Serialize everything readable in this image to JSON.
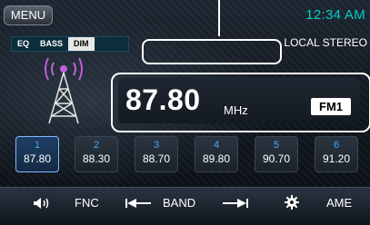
{
  "header": {
    "menu_label": "MENU",
    "clock": "12:34 AM",
    "mode": "LOCAL STEREO"
  },
  "eq": {
    "eq_label": "EQ",
    "bass_label": "BASS",
    "dim_label": "DIM"
  },
  "tuner": {
    "frequency": "87.80",
    "unit": "MHz",
    "band": "FM1"
  },
  "presets": [
    {
      "num": "1",
      "freq": "87.80",
      "active": true
    },
    {
      "num": "2",
      "freq": "88.30"
    },
    {
      "num": "3",
      "freq": "88.70"
    },
    {
      "num": "4",
      "freq": "89.80"
    },
    {
      "num": "5",
      "freq": "90.70"
    },
    {
      "num": "6",
      "freq": "91.20"
    }
  ],
  "bottom": {
    "fnc_label": "FNC",
    "band_label": "BAND",
    "ame_label": "AME",
    "icons": [
      "volume-icon",
      "seek-back-icon",
      "seek-forward-icon",
      "settings-gear-icon"
    ]
  },
  "colors": {
    "accent": "#00d0c8",
    "preset_num": "#40a9ff",
    "active_border": "#7fb7ff"
  }
}
